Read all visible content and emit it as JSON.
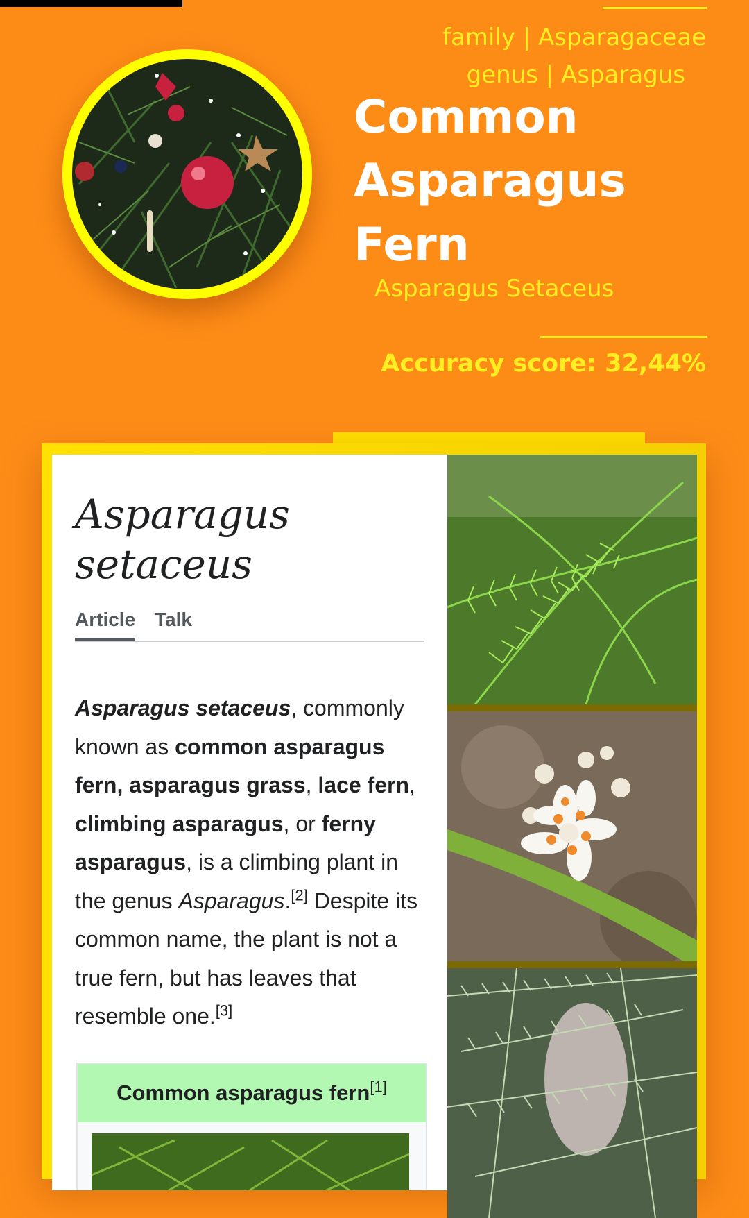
{
  "header": {
    "family": "family | Asparagaceae",
    "genus": "genus | Asparagus",
    "common_name_lines": [
      "Common",
      "Asparagus",
      "Fern"
    ],
    "scientific_name": "Asparagus Setaceus",
    "accuracy": "Accuracy score: 32,44%",
    "avatar_icon": "christmas-tree-photo"
  },
  "wiki": {
    "title_line1": "Asparagus",
    "title_line2": "setaceus",
    "tabs": [
      "Article",
      "Talk"
    ],
    "body": {
      "s1": "Asparagus setaceus",
      "s2": ", commonly known as ",
      "s3": "common asparagus fern, asparagus grass",
      "s4": ", ",
      "s5": "lace fern",
      "s6": ", ",
      "s7": "climbing asparagus",
      "s8": ", or ",
      "s9": "ferny asparagus",
      "s10": ", is a climbing plant in the genus ",
      "s11": "Asparagus",
      "s12": ".",
      "ref2": "[2]",
      "s13": " Despite its common name, the plant is not a true fern, but has leaves that resemble one.",
      "ref3": "[3]"
    },
    "infobox_title": "Common asparagus fern",
    "infobox_ref": "[1]"
  },
  "photos": [
    "fern-foliage-photo",
    "asparagus-flower-photo",
    "fern-branches-photo"
  ],
  "colors": {
    "background": "#fd8c17",
    "accent": "#ffee22",
    "card": "#ffe000"
  }
}
